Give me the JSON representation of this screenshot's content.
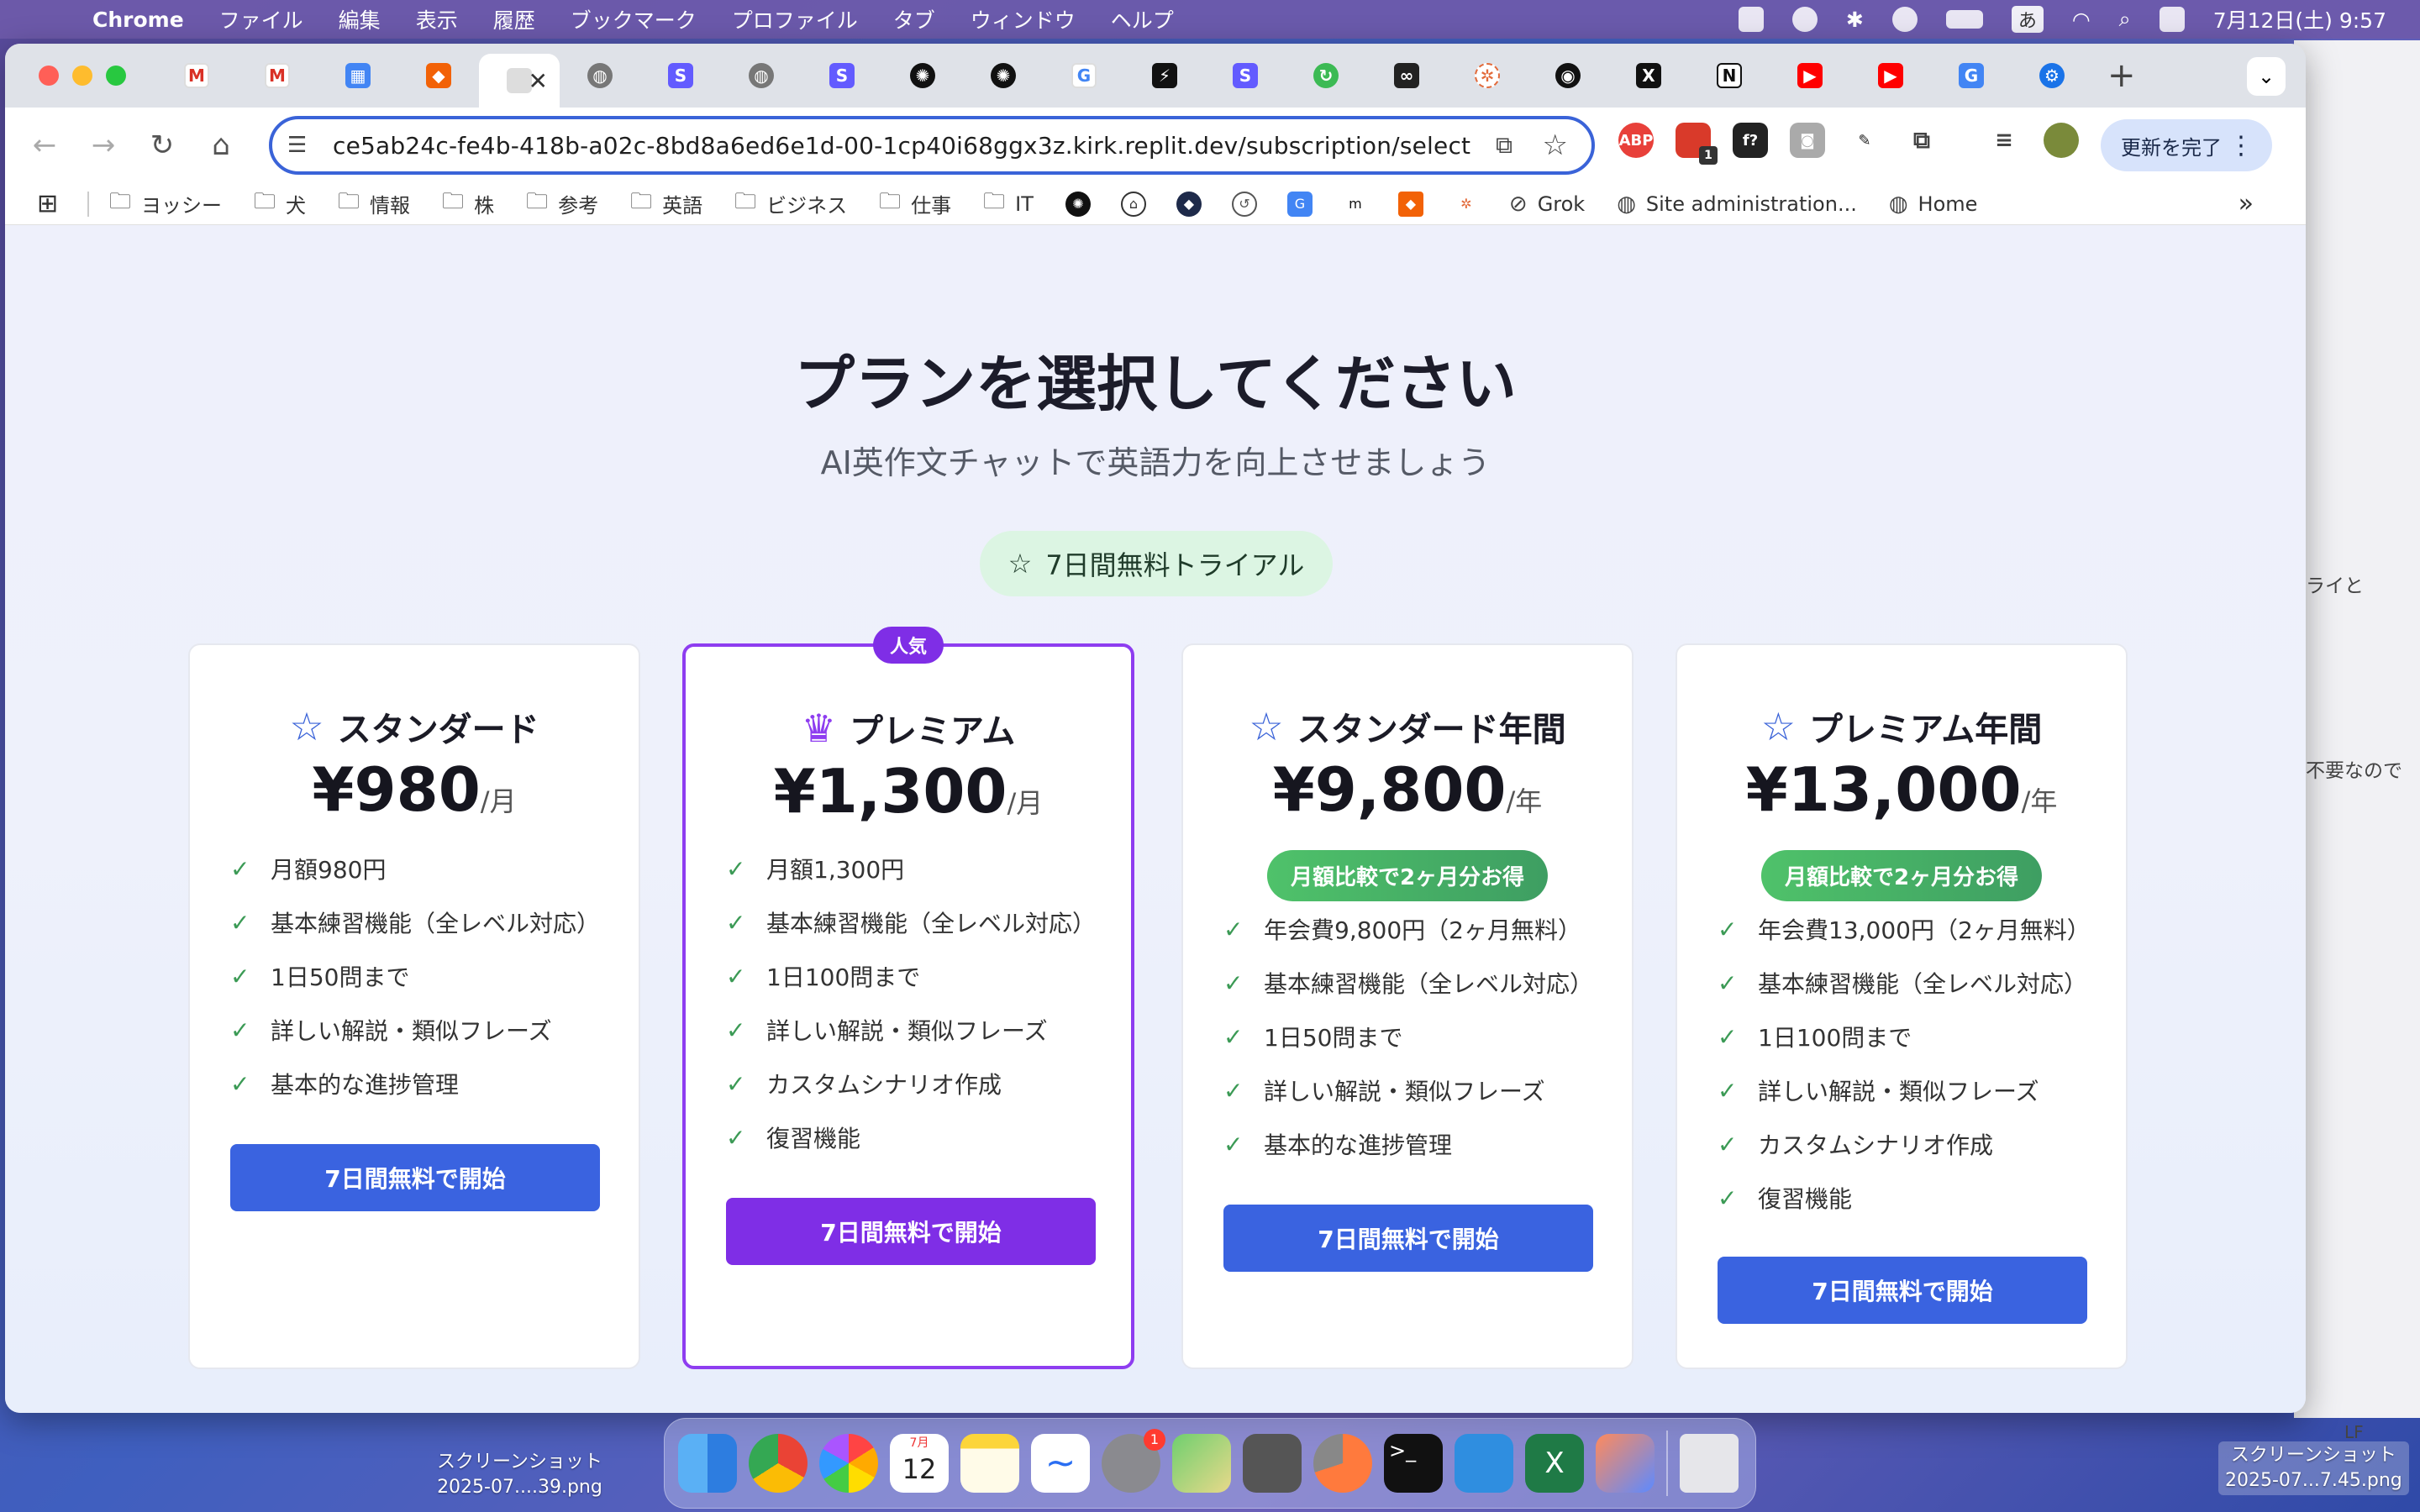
{
  "menubar": {
    "app": "Chrome",
    "items": [
      "ファイル",
      "編集",
      "表示",
      "履歴",
      "ブックマーク",
      "プロファイル",
      "タブ",
      "ウィンドウ",
      "ヘルプ"
    ],
    "ime": "あ",
    "clock": "7月12日(土)  9:57"
  },
  "browser": {
    "url": "ce5ab24c-fe4b-418b-a02c-8bd8a6ed6e1d-00-1cp40i68ggx3z.kirk.replit.dev/subscription/select",
    "update_button": "更新を完了",
    "bookmarks": {
      "folders": [
        "ヨッシー",
        "犬",
        "情報",
        "株",
        "参考",
        "英語",
        "ビジネス",
        "仕事",
        "IT"
      ],
      "links": [
        "Grok",
        "Site administration...",
        "Home"
      ]
    },
    "abp_badge": "1"
  },
  "page": {
    "title": "プランを選択してください",
    "subtitle": "AI英作文チャットで英語力を向上させましょう",
    "trial_badge": "7日間無料トライアル",
    "plans": [
      {
        "name": "スタンダード",
        "price": "¥980",
        "period": "/月",
        "features": [
          "月額980円",
          "基本練習機能（全レベル対応）",
          "1日50問まで",
          "詳しい解説・類似フレーズ",
          "基本的な進捗管理"
        ],
        "cta": "7日間無料で開始"
      },
      {
        "name": "プレミアム",
        "popular_label": "人気",
        "price": "¥1,300",
        "period": "/月",
        "features": [
          "月額1,300円",
          "基本練習機能（全レベル対応）",
          "1日100問まで",
          "詳しい解説・類似フレーズ",
          "カスタムシナリオ作成",
          "復習機能"
        ],
        "cta": "7日間無料で開始"
      },
      {
        "name": "スタンダード年間",
        "price": "¥9,800",
        "period": "/年",
        "save_badge": "月額比較で2ヶ月分お得",
        "features": [
          "年会費9,800円（2ヶ月無料）",
          "基本練習機能（全レベル対応）",
          "1日50問まで",
          "詳しい解説・類似フレーズ",
          "基本的な進捗管理"
        ],
        "cta": "7日間無料で開始"
      },
      {
        "name": "プレミアム年間",
        "price": "¥13,000",
        "period": "/年",
        "save_badge": "月額比較で2ヶ月分お得",
        "features": [
          "年会費13,000円（2ヶ月無料）",
          "基本練習機能（全レベル対応）",
          "1日100問まで",
          "詳しい解説・類似フレーズ",
          "カスタムシナリオ作成",
          "復習機能"
        ],
        "cta": "7日間無料で開始"
      }
    ]
  },
  "background_window": {
    "text1": "ライと",
    "text2": "不要なので",
    "text3": "LF"
  },
  "dock": {
    "calendar_month": "7月",
    "calendar_day": "12",
    "settings_badge": "1"
  },
  "desktop": {
    "file1_line1": "スクリーンショット",
    "file1_line2": "2025-07....39.png",
    "file2_line1": "スクリーンショット",
    "file2_line2": "2025-07...7.45.png"
  },
  "colors": {
    "primary_blue": "#3a63e0",
    "premium_purple": "#7f2ee6",
    "save_green": "#4fc26a",
    "trial_bg": "#dcf5e3"
  }
}
